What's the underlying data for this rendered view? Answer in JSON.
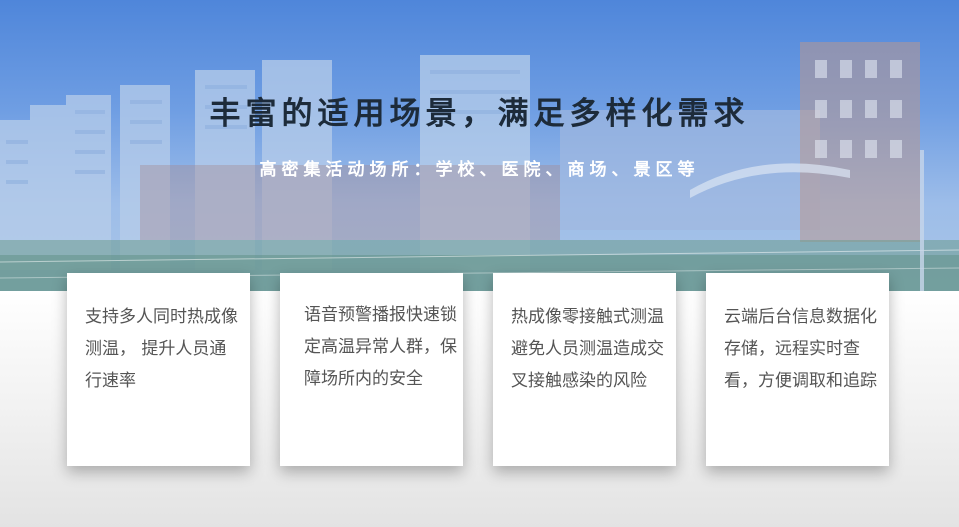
{
  "hero": {
    "title": "丰富的适用场景，满足多样化需求",
    "subtitle": "高密集活动场所：学校、医院、商场、景区等"
  },
  "cards": [
    {
      "text": "支持多人同时热成像测温， 提升人员通行速率"
    },
    {
      "text": "语音预警播报快速锁定高温异常人群，保障场所内的安全"
    },
    {
      "text": "热成像零接触式测温避免人员测温造成交叉接触感染的风险"
    },
    {
      "text": "云端后台信息数据化存储，远程实时查看，方便调取和追踪"
    }
  ]
}
